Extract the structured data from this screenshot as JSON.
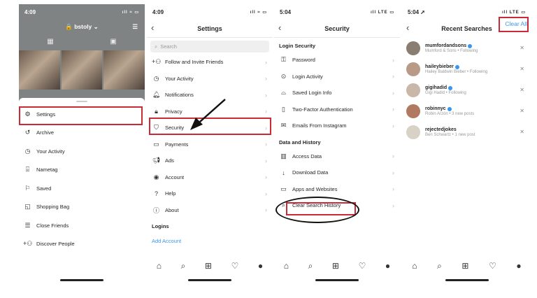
{
  "panel1": {
    "status_time": "4:09",
    "status_right": "ıll ≈ ▭",
    "username": "bstoly ⌄",
    "menu": [
      {
        "label": "Settings"
      },
      {
        "label": "Archive"
      },
      {
        "label": "Your Activity"
      },
      {
        "label": "Nametag"
      },
      {
        "label": "Saved"
      },
      {
        "label": "Shopping Bag"
      },
      {
        "label": "Close Friends"
      },
      {
        "label": "Discover People"
      }
    ]
  },
  "panel2": {
    "status_time": "4:09",
    "status_right": "ıll ≈ ▭",
    "title": "Settings",
    "search_placeholder": "Search",
    "items": [
      {
        "label": "Follow and Invite Friends"
      },
      {
        "label": "Your Activity"
      },
      {
        "label": "Notifications"
      },
      {
        "label": "Privacy"
      },
      {
        "label": "Security"
      },
      {
        "label": "Payments"
      },
      {
        "label": "Ads"
      },
      {
        "label": "Account"
      },
      {
        "label": "Help"
      },
      {
        "label": "About"
      }
    ],
    "logins_heading": "Logins",
    "add_account": "Add Account"
  },
  "panel3": {
    "status_time": "5:04",
    "status_right": "ıll LTE ▭",
    "title": "Security",
    "login_heading": "Login Security",
    "login_items": [
      {
        "label": "Password"
      },
      {
        "label": "Login Activity"
      },
      {
        "label": "Saved Login Info"
      },
      {
        "label": "Two-Factor Authentication"
      },
      {
        "label": "Emails From Instagram"
      }
    ],
    "data_heading": "Data and History",
    "data_items": [
      {
        "label": "Access Data"
      },
      {
        "label": "Download Data"
      },
      {
        "label": "Apps and Websites"
      },
      {
        "label": "Clear Search History"
      }
    ]
  },
  "panel4": {
    "status_time": "5:04 ➚",
    "status_right": "ıll LTE ▭",
    "title": "Recent Searches",
    "clear_all": "Clear All",
    "results": [
      {
        "username": "mumfordandsons",
        "sub": "Mumford & Sons • Following",
        "color": "#8a7d72"
      },
      {
        "username": "haileybieber",
        "sub": "Hailey Baldwin Bieber • Following",
        "color": "#b89a86"
      },
      {
        "username": "gigihadid",
        "sub": "Gigi Hadid • Following",
        "color": "#c9b8a8"
      },
      {
        "username": "robinnyc",
        "sub": "Robin Arzón • 3 new posts",
        "color": "#b07a62"
      },
      {
        "username": "rejectedjokes",
        "sub": "Ben Schwartz • 1 new post",
        "color": "#d8d2c6"
      }
    ]
  },
  "colors": {
    "highlight": "#c92a35",
    "link": "#3897f0"
  }
}
